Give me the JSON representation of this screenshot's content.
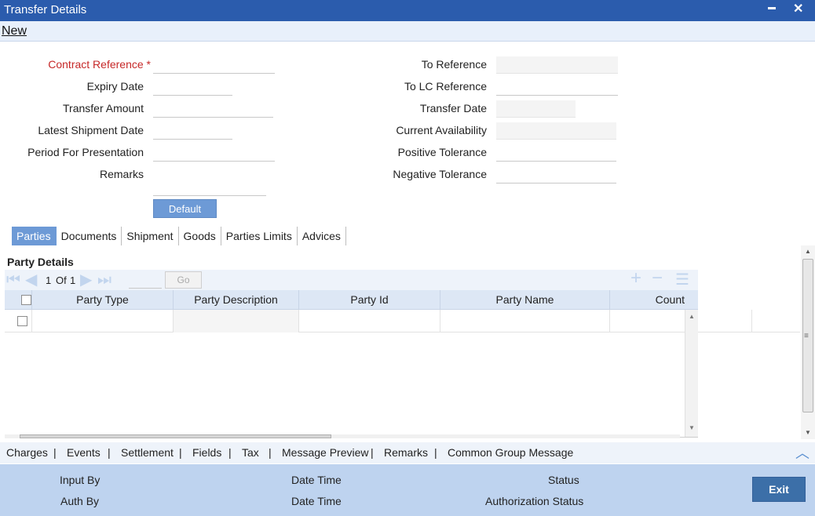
{
  "window": {
    "title": "Transfer Details",
    "minimize_glyph": "▬",
    "close_glyph": "✕"
  },
  "toolbar": {
    "new_label": "New"
  },
  "form": {
    "left": [
      {
        "label": "Contract Reference",
        "required_mark": "*",
        "value": ""
      },
      {
        "label": "Expiry Date",
        "value": ""
      },
      {
        "label": "Transfer Amount",
        "value": ""
      },
      {
        "label": "Latest Shipment Date",
        "value": ""
      },
      {
        "label": "Period For Presentation",
        "value": ""
      },
      {
        "label": "Remarks",
        "value": ""
      }
    ],
    "right": [
      {
        "label": "To Reference",
        "value": ""
      },
      {
        "label": "To LC Reference",
        "value": ""
      },
      {
        "label": "Transfer Date",
        "value": ""
      },
      {
        "label": "Current Availability",
        "value": ""
      },
      {
        "label": "Positive Tolerance",
        "value": ""
      },
      {
        "label": "Negative Tolerance",
        "value": ""
      }
    ],
    "default_button": "Default"
  },
  "tabs": [
    {
      "label": "Parties",
      "active": true
    },
    {
      "label": "Documents"
    },
    {
      "label": "Shipment"
    },
    {
      "label": "Goods"
    },
    {
      "label": "Parties Limits"
    },
    {
      "label": "Advices"
    }
  ],
  "party_details": {
    "title": "Party Details",
    "pager": {
      "current": "1",
      "of_label": "Of",
      "total": "1",
      "go_label": "Go",
      "go_value": ""
    },
    "columns": [
      "Party Type",
      "Party Description",
      "Party Id",
      "Party Name",
      "Count"
    ],
    "rows": [
      {
        "cells": [
          "",
          "",
          "",
          "",
          ""
        ]
      }
    ]
  },
  "bottom_links": [
    "Charges",
    "Events",
    "Settlement",
    "Fields",
    "Tax",
    "Message Preview",
    "Remarks",
    "Common Group Message"
  ],
  "footer": {
    "input_by": "Input By",
    "date_time_1": "Date Time",
    "status": "Status",
    "auth_by": "Auth By",
    "date_time_2": "Date Time",
    "authorization_status": "Authorization Status",
    "exit_label": "Exit"
  },
  "icons": {
    "first_page": "first-page-icon",
    "prev_page": "prev-page-icon",
    "next_page": "next-page-icon",
    "last_page": "last-page-icon",
    "add_row": "add-row-icon",
    "delete_row": "delete-row-icon",
    "view_row": "view-row-icon",
    "scroll_up": "chevron-up-icon"
  },
  "colors": {
    "titlebar": "#2b5cad",
    "accent": "#6d9ad6",
    "footer": "#bed3ef",
    "exit": "#3c6fa8",
    "required": "#c62828"
  }
}
